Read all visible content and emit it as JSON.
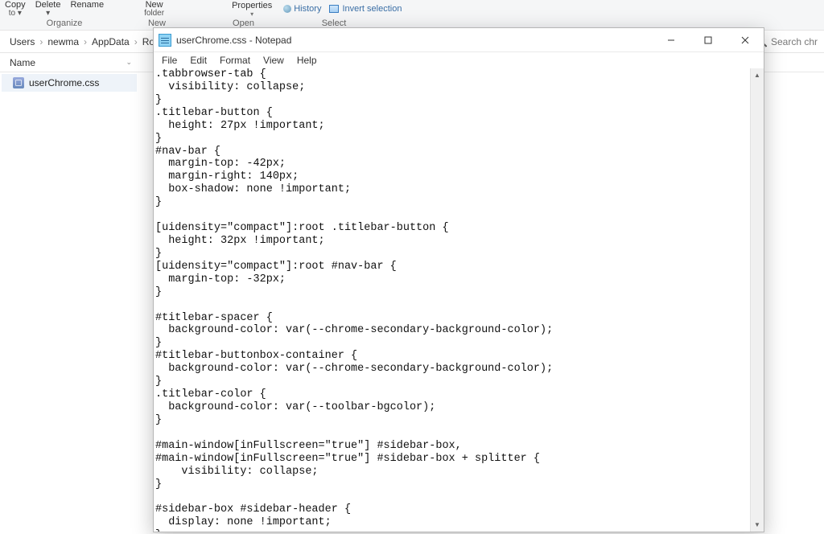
{
  "explorer": {
    "ribbon": {
      "copy_to": {
        "l1": "Copy",
        "l2": "to ▾"
      },
      "delete": {
        "l1": "Delete",
        "l2": "▾"
      },
      "rename": "Rename",
      "new_folder": {
        "l1": "New",
        "l2": "folder"
      },
      "properties": {
        "l1": "Properties",
        "l2": "▾"
      },
      "history": "History",
      "invert": "Invert selection",
      "sections": {
        "organize": "Organize",
        "new": "New",
        "open": "Open",
        "select": "Select"
      }
    },
    "breadcrumb": [
      "Users",
      "newma",
      "AppData",
      "Roa"
    ],
    "search_placeholder": "Search chr",
    "column_header": "Name",
    "file_name": "userChrome.css"
  },
  "notepad": {
    "title": "userChrome.css - Notepad",
    "menu": [
      "File",
      "Edit",
      "Format",
      "View",
      "Help"
    ],
    "content": ".tabbrowser-tab {\n  visibility: collapse;\n}\n.titlebar-button {\n  height: 27px !important;\n}\n#nav-bar {\n  margin-top: -42px;\n  margin-right: 140px;\n  box-shadow: none !important;\n}\n\n[uidensity=\"compact\"]:root .titlebar-button {\n  height: 32px !important;\n}\n[uidensity=\"compact\"]:root #nav-bar {\n  margin-top: -32px;\n}\n\n#titlebar-spacer {\n  background-color: var(--chrome-secondary-background-color);\n}\n#titlebar-buttonbox-container {\n  background-color: var(--chrome-secondary-background-color);\n}\n.titlebar-color {\n  background-color: var(--toolbar-bgcolor);\n}\n\n#main-window[inFullscreen=\"true\"] #sidebar-box,\n#main-window[inFullscreen=\"true\"] #sidebar-box + splitter {\n    visibility: collapse;\n}\n\n#sidebar-box #sidebar-header {\n  display: none !important;\n}"
  }
}
